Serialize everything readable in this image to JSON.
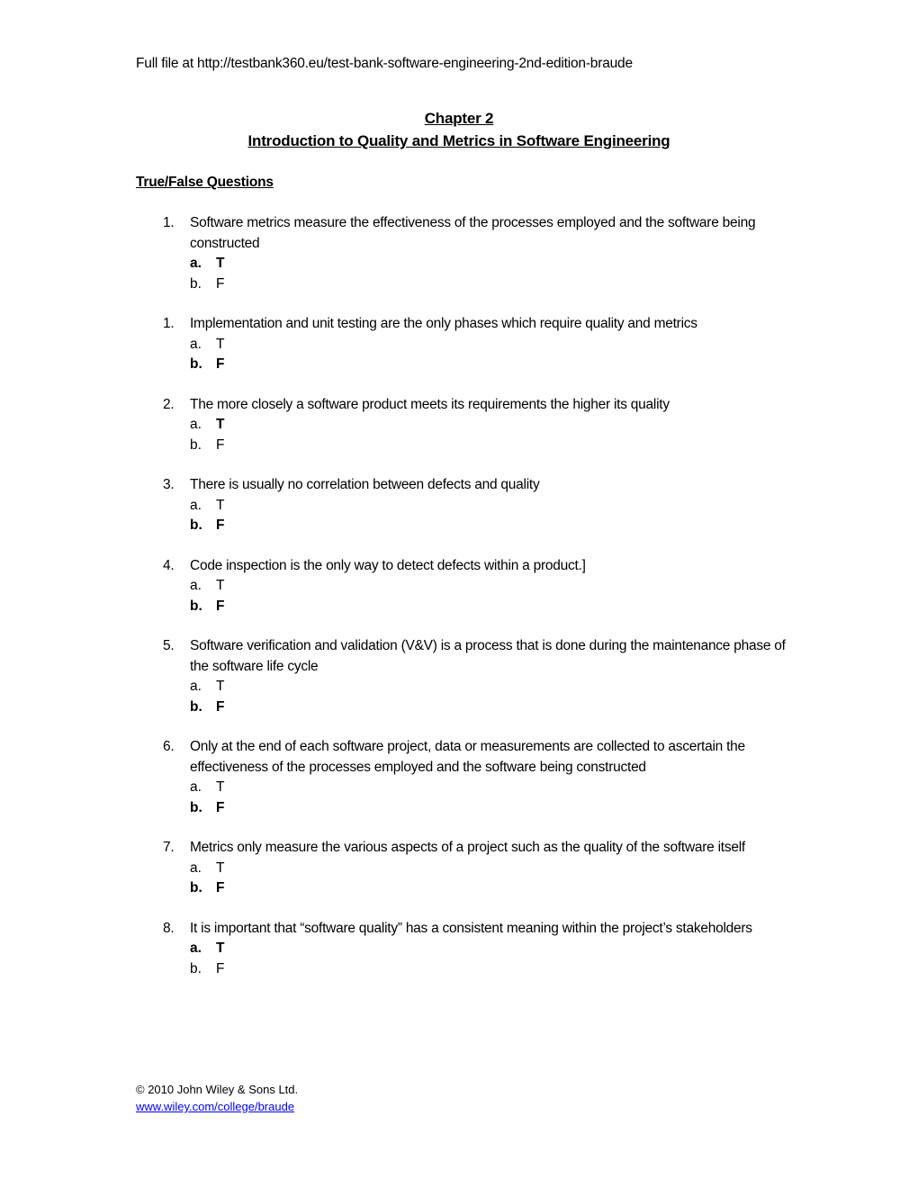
{
  "header": {
    "source_line": "Full file at http://testbank360.eu/test-bank-software-engineering-2nd-edition-braude"
  },
  "title": {
    "chapter": "Chapter 2",
    "subtitle": "Introduction to Quality and Metrics in Software Engineering"
  },
  "section": {
    "title": "True/False Questions"
  },
  "questions": [
    {
      "number": "1.",
      "text": "Software metrics measure the effectiveness of the processes employed and the software being constructed",
      "options": [
        {
          "letter": "a.",
          "value": "T",
          "correct": true
        },
        {
          "letter": "b.",
          "value": "F",
          "correct": false
        }
      ]
    },
    {
      "number": "1.",
      "text": "Implementation and unit testing are the only phases which require quality and metrics",
      "options": [
        {
          "letter": "a.",
          "value": "T",
          "correct": false
        },
        {
          "letter": "b.",
          "value": "F",
          "correct": true
        }
      ]
    },
    {
      "number": "2.",
      "text": "The more closely a software product meets its requirements the higher its quality",
      "options": [
        {
          "letter": "a.",
          "value": "T",
          "correct": "value-only"
        },
        {
          "letter": "b.",
          "value": "F",
          "correct": false
        }
      ]
    },
    {
      "number": "3.",
      "text": "There is usually no correlation between defects and quality",
      "options": [
        {
          "letter": "a.",
          "value": "T",
          "correct": false
        },
        {
          "letter": "b.",
          "value": "F",
          "correct": true
        }
      ]
    },
    {
      "number": "4.",
      "text": "Code inspection is the only way to detect defects within a product.]",
      "options": [
        {
          "letter": "a.",
          "value": "T",
          "correct": false
        },
        {
          "letter": "b.",
          "value": "F",
          "correct": true
        }
      ]
    },
    {
      "number": "5.",
      "text": "Software verification and validation (V&V) is a process that is done during the maintenance phase of the software life cycle",
      "options": [
        {
          "letter": "a.",
          "value": "T",
          "correct": false
        },
        {
          "letter": "b.",
          "value": "F",
          "correct": true
        }
      ]
    },
    {
      "number": "6.",
      "text": "Only at the end of each software project, data or measurements are collected to ascertain the effectiveness of the processes employed and the software being constructed",
      "options": [
        {
          "letter": "a.",
          "value": "T",
          "correct": false
        },
        {
          "letter": "b.",
          "value": "F",
          "correct": true
        }
      ]
    },
    {
      "number": "7.",
      "text": "Metrics only measure the various aspects of a project such as the quality of the software itself",
      "options": [
        {
          "letter": "a.",
          "value": "T",
          "correct": false
        },
        {
          "letter": "b.",
          "value": "F",
          "correct": true
        }
      ]
    },
    {
      "number": "8.",
      "text": "It is important that “software quality” has a consistent meaning within the project’s stakeholders",
      "options": [
        {
          "letter": "a.",
          "value": "T",
          "correct": true
        },
        {
          "letter": "b.",
          "value": "F",
          "correct": false
        }
      ]
    }
  ],
  "footer": {
    "copyright": "© 2010 John Wiley & Sons Ltd.",
    "link_text": "www.wiley.com/college/braude"
  }
}
